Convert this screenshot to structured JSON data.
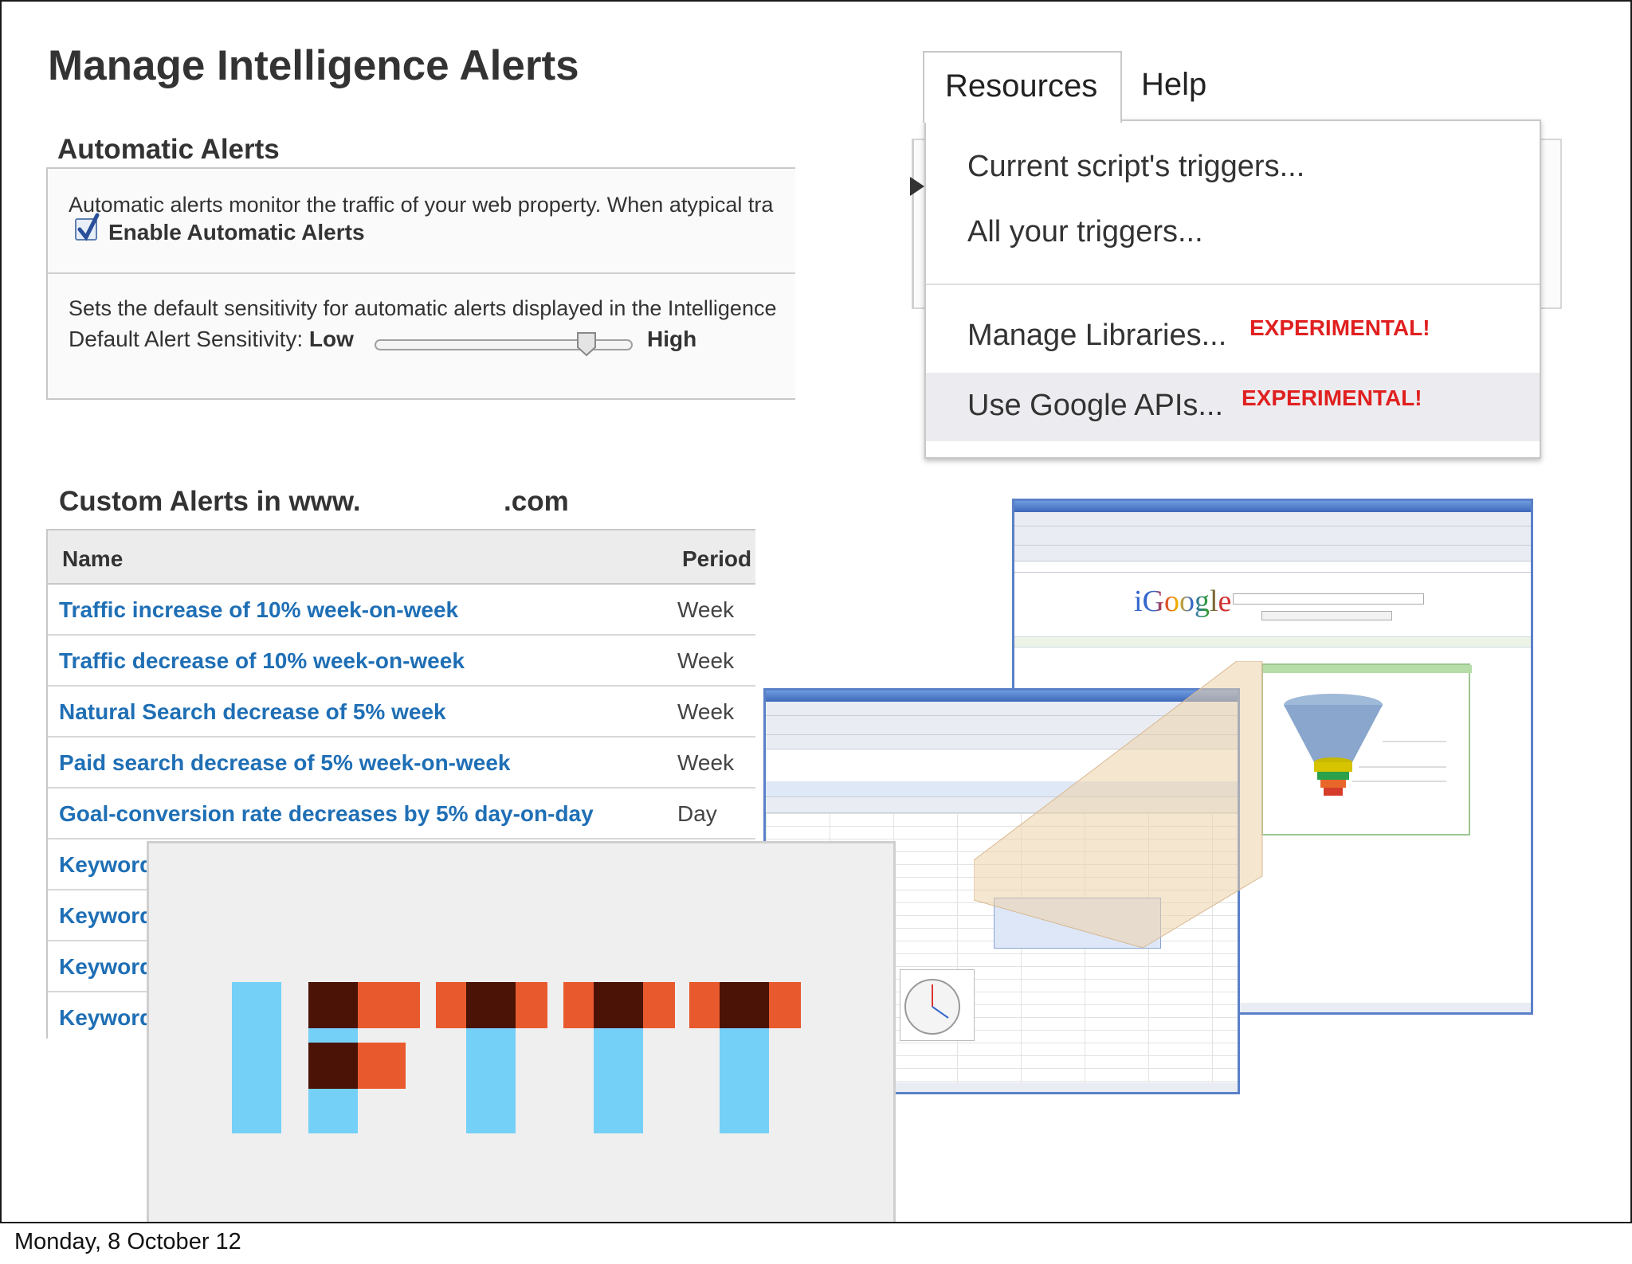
{
  "page": {
    "title": "Manage Intelligence Alerts",
    "footer_date": "Monday, 8 October 12"
  },
  "automatic_alerts": {
    "heading": "Automatic Alerts",
    "description": "Automatic alerts monitor the traffic of your web property. When atypical tra",
    "enable_label": "Enable Automatic Alerts",
    "enable_checked": true,
    "sensitivity_description": "Sets the default sensitivity for automatic alerts displayed in the Intelligence",
    "sensitivity_label": "Default Alert Sensitivity:",
    "sensitivity_low": "Low",
    "sensitivity_high": "High",
    "sensitivity_level": 0.85
  },
  "custom_alerts": {
    "heading_prefix": "Custom Alerts in www.",
    "heading_suffix": ".com",
    "columns": {
      "name": "Name",
      "period": "Period"
    },
    "rows": [
      {
        "name": "Traffic increase of 10% week-on-week",
        "period": "Week"
      },
      {
        "name": "Traffic decrease of 10% week-on-week",
        "period": "Week"
      },
      {
        "name": "Natural Search decrease of 5% week",
        "period": "Week"
      },
      {
        "name": "Paid search decrease of 5% week-on-week",
        "period": "Week"
      },
      {
        "name": "Goal-conversion rate decreases by 5% day-on-day",
        "period": "Day"
      },
      {
        "name": "Keyword",
        "period": ""
      },
      {
        "name": "Keyword",
        "period": ""
      },
      {
        "name": "Keyword",
        "period": ""
      },
      {
        "name": "Keyword",
        "period": ""
      }
    ]
  },
  "resources_menu": {
    "tab_resources": "Resources",
    "tab_help": "Help",
    "items": [
      {
        "label": "Current script's triggers...",
        "badge": ""
      },
      {
        "label": "All your triggers...",
        "badge": ""
      },
      {
        "label": "Manage Libraries...",
        "badge": "EXPERIMENTAL!"
      },
      {
        "label": "Use Google APIs...",
        "badge": "EXPERIMENTAL!"
      }
    ],
    "badge_color": "#e02020"
  },
  "igoogle": {
    "logo_text": "iGoogle"
  },
  "colors": {
    "link_blue": "#1f6fb5",
    "ifttt_blue": "#75d0f7",
    "ifttt_orange": "#e85a2e",
    "ifttt_dark": "#4a1305"
  }
}
